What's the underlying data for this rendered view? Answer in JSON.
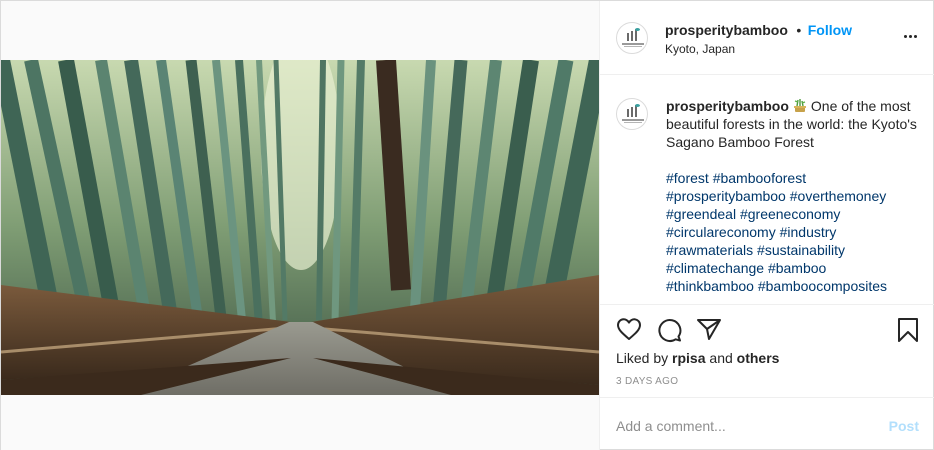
{
  "post": {
    "username": "prosperitybamboo",
    "separator": "•",
    "follow_label": "Follow",
    "location": "Kyoto, Japan",
    "caption": {
      "username": "prosperitybamboo",
      "emoji": "bamboo-pot-emoji",
      "text": "One of the most beautiful forests in the world: the Kyoto's Sagano Bamboo Forest",
      "hashtags": [
        "#forest",
        "#bambooforest",
        "#prosperitybamboo",
        "#overthemoney",
        "#greendeal",
        "#greeneconomy",
        "#circulareconomy",
        "#industry",
        "#rawmaterials",
        "#sustainability",
        "#climatechange",
        "#bamboo",
        "#thinkbamboo",
        "#bamboocomposites"
      ]
    },
    "liked_by_prefix": "Liked by",
    "liked_by_user": "rpisa",
    "liked_by_and": "and",
    "liked_by_others": "others",
    "timestamp": "3 DAYS AGO",
    "comment_placeholder": "Add a comment...",
    "post_label": "Post"
  },
  "icons": {
    "like": "heart-icon",
    "comment": "comment-icon",
    "share": "paper-plane-icon",
    "save": "bookmark-icon",
    "more": "more-options-icon"
  },
  "colors": {
    "link_blue": "#0095f6",
    "hashtag": "#00376b",
    "post_disabled": "#b2dffc",
    "muted": "#8e8e8e"
  }
}
